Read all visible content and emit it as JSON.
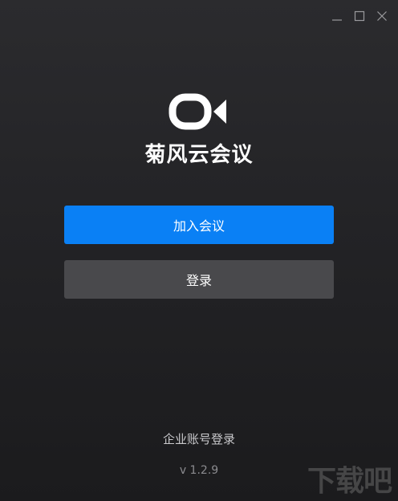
{
  "app": {
    "title": "菊风云会议",
    "version": "v 1.2.9"
  },
  "window_controls": {
    "minimize_icon": "minimize-icon",
    "maximize_icon": "maximize-icon",
    "close_icon": "close-icon"
  },
  "buttons": {
    "join": "加入会议",
    "login": "登录"
  },
  "links": {
    "enterprise_login": "企业账号登录"
  },
  "watermark": "下载吧",
  "colors": {
    "primary": "#0a80f5",
    "secondary": "#49494c",
    "background": "#232326"
  }
}
